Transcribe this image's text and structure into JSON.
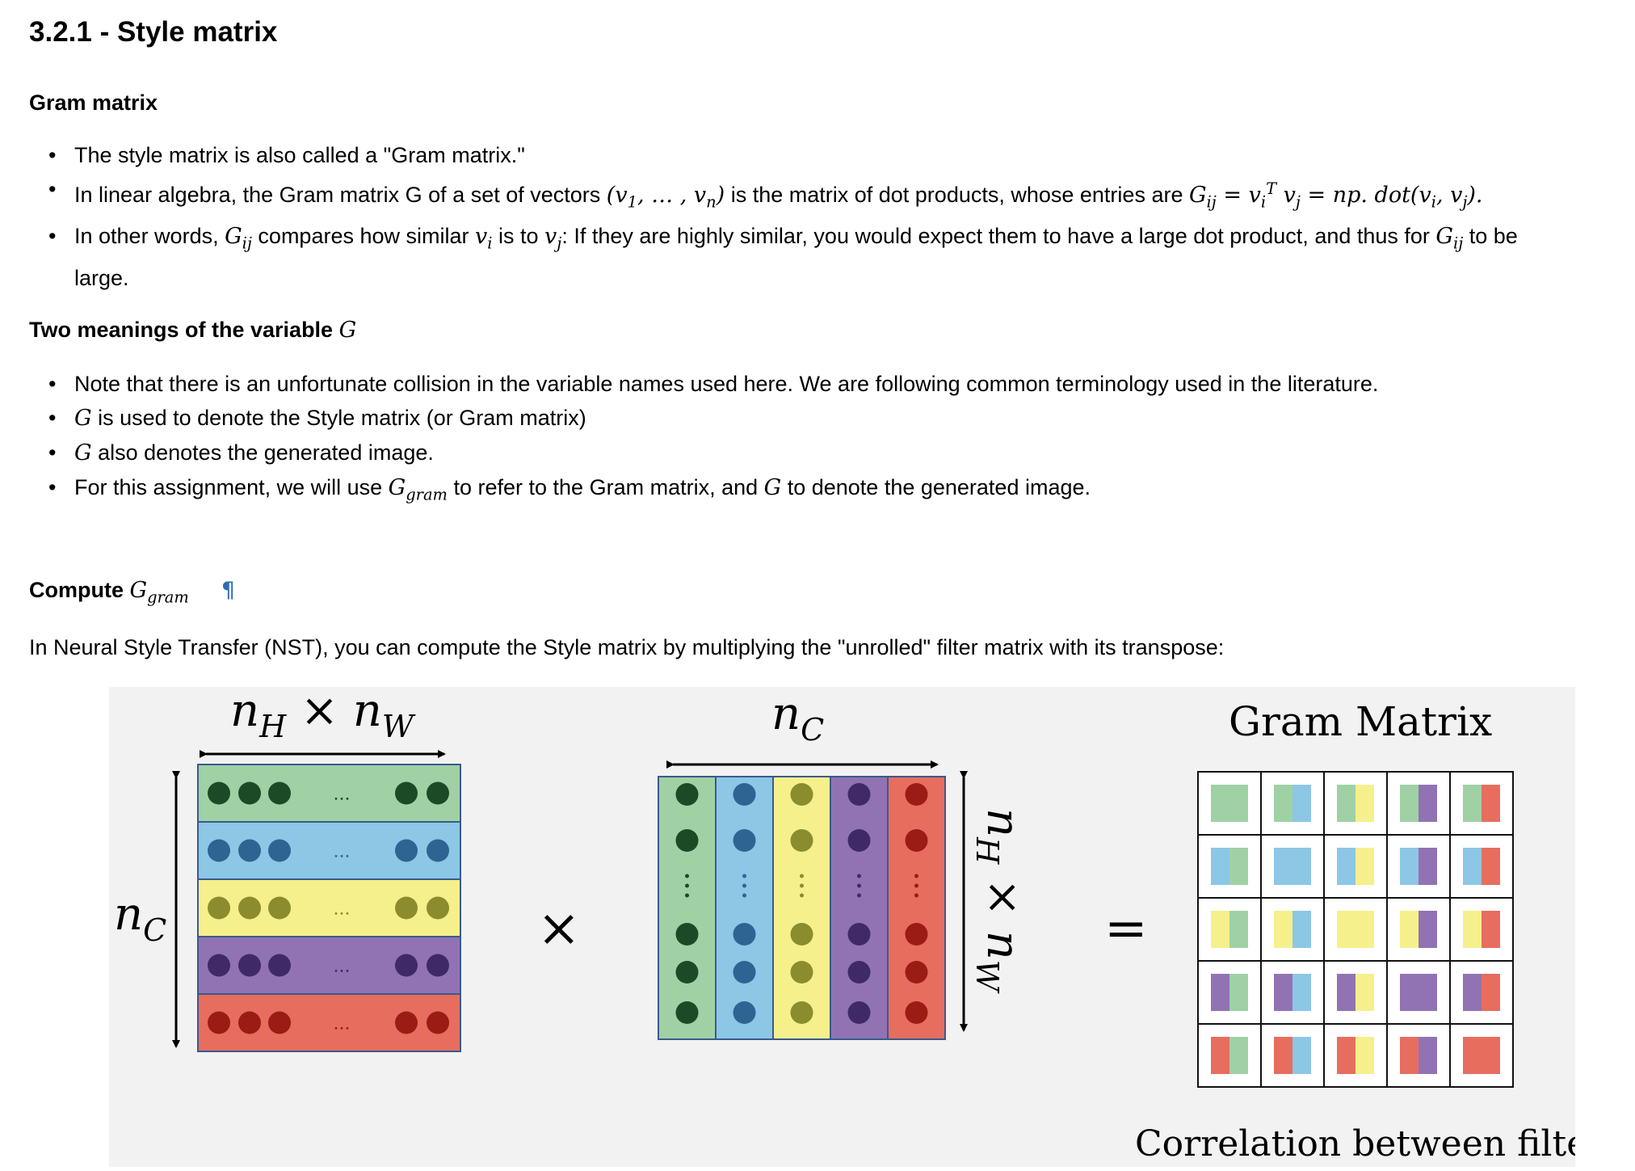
{
  "title": "3.2.1 - Style matrix",
  "gram_section": {
    "heading": "Gram matrix",
    "b1": "The style matrix is also called a \"Gram matrix.\"",
    "b2_pre": "In linear algebra, the Gram matrix G of a set of vectors ",
    "b2_mid": " is the matrix of dot products, whose entries are ",
    "b3_pre": "In other words, ",
    "b3_a": " compares how similar ",
    "b3_b": " is to ",
    "b3_c": ": If they are highly similar, you would expect them to have a large dot product, and thus for ",
    "b3_d": " to be",
    "b3_e": "large."
  },
  "two_meanings": {
    "heading": "Two meanings of the variable ",
    "b1": "Note that there is an unfortunate collision in the variable names used here. We are following common terminology used in the literature.",
    "b2": " is used to denote the Style matrix (or Gram matrix)",
    "b3": " also denotes the generated image.",
    "b4_pre": "For this assignment, we will use ",
    "b4_mid": " to refer to the Gram matrix, and ",
    "b4_post": " to denote the generated image."
  },
  "compute": {
    "heading": "Compute ",
    "pilcrow": "¶",
    "paragraph": "In Neural Style Transfer (NST), you can compute the Style matrix by multiplying the \"unrolled\" filter matrix with its transpose:"
  },
  "figure": {
    "left_width_label": "n_H × n_W",
    "left_height_label": "n_C",
    "times": "×",
    "mid_width_label": "n_C",
    "mid_height_label": "n_H × n_W",
    "equals": "=",
    "gram_title": "Gram Matrix",
    "caption": "Correlation between filters",
    "ellipsis": "...",
    "colors": {
      "green": "#9fd1a5",
      "blue": "#8cc7e6",
      "yellow": "#f5f08c",
      "purple": "#9173b3",
      "red": "#e76d5f"
    },
    "dot_colors": {
      "green": "#1d4a26",
      "blue": "#2d6491",
      "yellow": "#8b8c2e",
      "purple": "#3f2a67",
      "red": "#9b1c14"
    }
  }
}
